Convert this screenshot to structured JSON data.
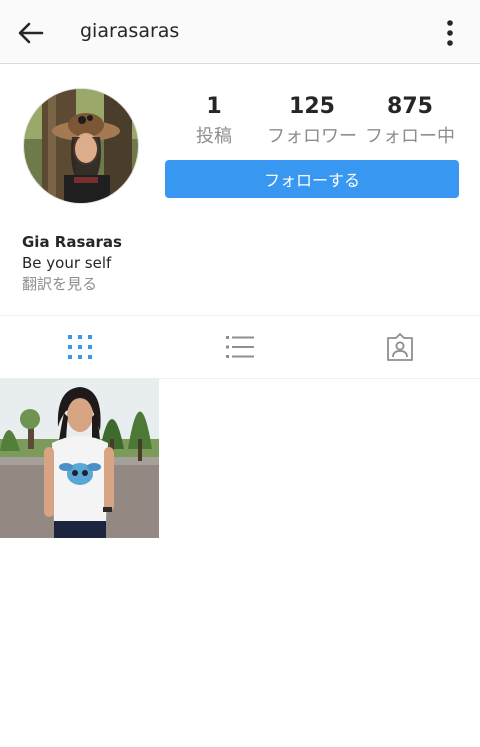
{
  "header": {
    "username": "giarasaras",
    "back_icon": "arrow-left-icon",
    "more_icon": "more-vertical-icon"
  },
  "profile": {
    "stats": [
      {
        "value": "1",
        "label": "投稿"
      },
      {
        "value": "125",
        "label": "フォロワー"
      },
      {
        "value": "875",
        "label": "フォロー中"
      }
    ],
    "follow_label": "フォローする",
    "name": "Gia Rasaras",
    "bio": "Be your self",
    "translate_label": "翻訳を見る"
  },
  "tabs": [
    {
      "name": "grid",
      "icon": "grid-icon",
      "active": true
    },
    {
      "name": "list",
      "icon": "list-icon",
      "active": false
    },
    {
      "name": "tagged",
      "icon": "tagged-person-icon",
      "active": false
    }
  ],
  "colors": {
    "accent": "#3897f0",
    "text": "#262626",
    "muted": "#8e8e8e",
    "header_bg": "#fafafa"
  }
}
